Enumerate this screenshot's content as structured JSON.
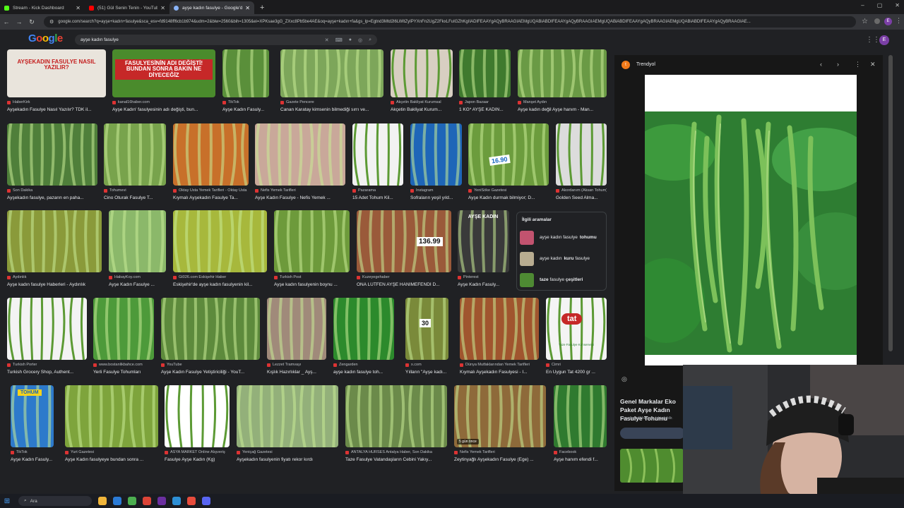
{
  "tabs": [
    {
      "title": "Stream - Kick Dashboard",
      "color": "#53fc18",
      "active": false
    },
    {
      "title": "(51) Gül Senin Tenin - YouTube",
      "color": "#ff0000",
      "active": false
    },
    {
      "title": "ayşe kadın fasulye - Google'da Ara",
      "color": "#8ab4f8",
      "active": true
    }
  ],
  "window_controls": [
    "–",
    "▢",
    "✕"
  ],
  "address_bar": {
    "url": "google.com/search?q=ayşe+kadın+fasulye&sca_esv=fd9148ff6cb1b974&udm=2&biw=2560&bih=1305&ei=XPKsae3gG_ZXxc8Pb5be4AE&oq=ayşe+kadın+fa&gs_lp=Egtnd3Mtd2l6LWltZyIPYXnFn2UgZ2FkxLFuIGZhKgIIADIFEAAYgAQyBRAAGIAEMgUQABiABDIFEAAYgAQyBRAAGIAEMgUQABiABDIFEAAYgAQyBRAAGIAEMgUQABiABDIFEAAYgAQyBRAAGIAE..."
  },
  "google": {
    "logo": "Google",
    "query": "ayşe kadın fasulye"
  },
  "results": [
    {
      "src": "HaberKirk",
      "title": "Ayşekadın Fasulye Nasıl Yazılır? TDK il...",
      "color": "#e9e4dc",
      "overlay": "AYŞEKADIN FASULYE NASIL YAZILIR?",
      "overlay_color": "#c41e1e"
    },
    {
      "src": "kanal16haber.com",
      "title": "Ayşe Kadın' fasulyesinin adı değişti, bun...",
      "color": "#4a8b2c",
      "overlay": "FASULYESİNİN ADI DEĞİŞTİ! BUNDAN SONRA BAKIN NE DİYECEĞİZ",
      "overlay_color": "#ffffff"
    },
    {
      "src": "TikTok",
      "title": "Ayşe Kadın Fasuly...",
      "color": "#5a8f3a"
    },
    {
      "src": "Gazete Pencere",
      "title": "Canan Karatay kimsenin bilmediği sırrı ve...",
      "color": "#7da65a"
    },
    {
      "src": "Akçetin Bakliyat Kurumsal",
      "title": "Akçetin Bakliyat Kurum...",
      "color": "#d8cfc2"
    },
    {
      "src": "Japon Bazaar",
      "title": "1 KG* AYŞE KADIN...",
      "color": "#3f7a2e"
    },
    {
      "src": "Manşet Aydın",
      "title": "Ayşe kadın değil Ayşe hanım - Man...",
      "color": "#6a9a45"
    },
    {
      "src": "Son Dakika",
      "title": "Ayşekadın fasulye, pazarın en paha...",
      "color": "#4f7f3a"
    },
    {
      "src": "Tohumevi",
      "title": "Cino Oturak Fasulye T...",
      "color": "#78a34c"
    },
    {
      "src": "Oktay Usta Yemek Tarifleri - Oktay Usta",
      "title": "Kıymalı Ayşekadın Fasulye Ta...",
      "color": "#c8702a"
    },
    {
      "src": "Nefis Yemek Tarifleri",
      "title": "Ayşe Kadın Fasulye - Nefis Yemek ...",
      "color": "#c9a89a"
    },
    {
      "src": "Pazarama",
      "title": "15 Adet Tohum Kil...",
      "color": "#f2f2f2"
    },
    {
      "src": "Instagram",
      "title": "Sofraların yeşil yıld...",
      "color": "#1e66b8"
    },
    {
      "src": "YeniSöke Gazetesi",
      "title": "Ayşe Kadın durmak bilmiyor; D...",
      "color": "#6c9c3d"
    },
    {
      "src": "Akordanım (Aksan Tohum)",
      "title": "Golden Seed Alma...",
      "color": "#dcdcdc"
    },
    {
      "src": "Aydınlık",
      "title": "Ayşe kadın fasulye Haberleri - Aydınlık",
      "color": "#8a9a3a"
    },
    {
      "src": "HabayKoy.com",
      "title": "Ayşe Kadın Fasulye ...",
      "color": "#8bb86a"
    },
    {
      "src": "Gt026.com Eskişehir Haber",
      "title": "Eskişehir'de ayşe kadın fasulyenin kil...",
      "color": "#a7b83c"
    },
    {
      "src": "Turkish Post",
      "title": "Ayşe kadın fasulyenin boynu ...",
      "color": "#6d9a3b"
    },
    {
      "src": "Kuzeyegehaber",
      "title": "ONA LÜTFEN AYŞE HANIMEFENDİ D...",
      "color": "#9a5a3a"
    },
    {
      "src": "Pinterest",
      "title": "Ayşe Kadın Fasuly...",
      "color": "#3a3a3a"
    },
    {
      "src": "Turkish Porter",
      "title": "Turkish Grocery Shop, Authent...",
      "color": "#f3f3f3"
    },
    {
      "src": "www.bostanlikbahce.com",
      "title": "Yerli Fasulye Tohumları",
      "color": "#4d9a3a"
    },
    {
      "src": "YouTube",
      "title": "Ayşe Kadın Fasulye Yetiştiriciliği - YouT...",
      "color": "#5d8a3c"
    },
    {
      "src": "Lezzet Tramvayı",
      "title": "Kışlık Hazırlıklar _ Ayş...",
      "color": "#a08a7a"
    },
    {
      "src": "Zengarden",
      "title": "ayşe kadın fasulye toh...",
      "color": "#2c8a2c"
    },
    {
      "src": "x.com",
      "title": "Yılların \"Ayşe kadı...",
      "color": "#7a8a3a"
    },
    {
      "src": "Dünya Mutfaklarından Yemek Tarifleri",
      "title": "Kıymalı Ayşekadın Fasulyesi - I...",
      "color": "#a0552e"
    },
    {
      "src": "Cimri",
      "title": "En Uygun Tat 4200 gr ...",
      "color": "#f4f4f4"
    },
    {
      "src": "TikTok",
      "title": "Ayşe Kadın Fasuly...",
      "color": "#2d7acb"
    },
    {
      "src": "Yurt Gazetesi",
      "title": "Ayşe Kadın fasulyeye bundan sonra ...",
      "color": "#7ea43c"
    },
    {
      "src": "ASYA MARKET Online Alışveriş",
      "title": "Fasulye Ayşe Kadın (Kg)",
      "color": "#ffffff"
    },
    {
      "src": "Yeniçağ Gazetesi",
      "title": "Ayşekadın fasulyenin fiyatı rekor kırdı",
      "color": "#93b07a"
    },
    {
      "src": "ANTALYA HÜRSES Antalya Haber, Son Dakika",
      "title": "Taze Fasulye Vatandaşların Cebini Yakıy...",
      "color": "#6b8a4a"
    },
    {
      "src": "Nefis Yemek Tarifleri",
      "title": "Zeytinyağlı Ayşekadın Fasulye (Ege) ...",
      "color": "#8e6a3a"
    },
    {
      "src": "Facebook",
      "title": "Ayşe hanım efendi f...",
      "color": "#2f7a2f"
    }
  ],
  "badges": {
    "iyilik": "5 gün önce",
    "r_tohum": "TOHUM",
    "tat": "tat",
    "tat_sub": "Taze Fasulye Konservesi",
    "price1": "16.90",
    "price2": "136.99",
    "price3": "30",
    "ayse": "AYŞE KADIN"
  },
  "related": {
    "heading": "İlgili aramalar",
    "items": [
      {
        "prefix": "ayşe kadın fasulye",
        "bold": "tohumu",
        "color": "#c2536f"
      },
      {
        "prefix": "ayşe kadın",
        "bold": "kuru",
        "suffix": "fasulye",
        "color": "#b8ac90"
      },
      {
        "prefix": "",
        "bold": "taze",
        "suffix": "fasulye",
        "bold2": "çeşitleri",
        "color": "#4e8a33"
      }
    ]
  },
  "preview": {
    "site": "Trendyol",
    "title": "Genel Markalar Eko Paket Ayşe Kadın Fasulye Tohumu",
    "subtitle": "Görseller telif hakkına tabi olabilir."
  },
  "taskbar": {
    "search_placeholder": "Ara",
    "apps": [
      "#f0b53a",
      "#2b7bd6",
      "#4caf50",
      "#dc4437",
      "#6b2fa0",
      "#2d8fd5",
      "#e74c3c",
      "#5865f2"
    ]
  }
}
